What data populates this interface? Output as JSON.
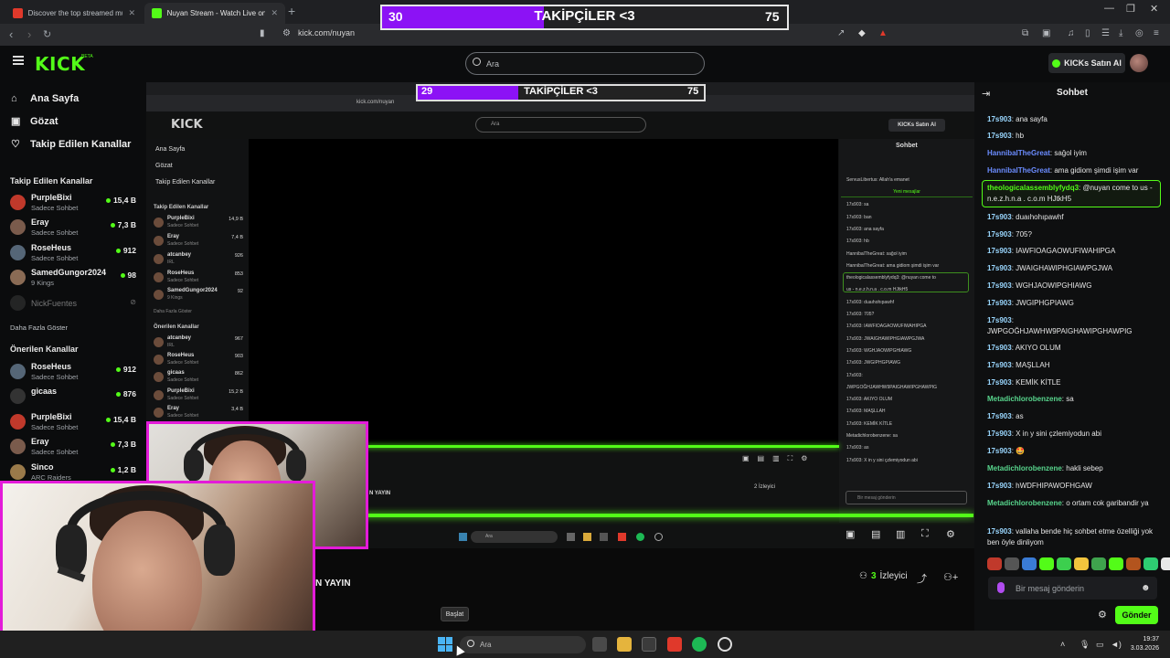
{
  "browser": {
    "tabs": [
      {
        "title": "Discover the top streamed music and"
      },
      {
        "title": "Nuyan Stream - Watch Live on K"
      }
    ],
    "url": "kick.com/nuyan"
  },
  "header": {
    "logo": "KICK",
    "logo_badge": "BETA",
    "search_placeholder": "Ara",
    "buy_label": "KICKs Satın Al"
  },
  "sidebar": {
    "nav": [
      {
        "label": "Ana Sayfa"
      },
      {
        "label": "Gözat"
      },
      {
        "label": "Takip Edilen Kanallar"
      }
    ],
    "followed_title": "Takip Edilen Kanallar",
    "followed": [
      {
        "name": "PurpleBixi",
        "sub": "Sadece Sohbet",
        "count": "15,4 B",
        "color": "#c0392b"
      },
      {
        "name": "Eray",
        "sub": "Sadece Sohbet",
        "count": "7,3 B",
        "color": "#7a5b4c"
      },
      {
        "name": "RoseHeus",
        "sub": "Sadece Sohbet",
        "count": "912",
        "color": "#556677"
      },
      {
        "name": "SamedGungor2024",
        "sub": "9 Kings",
        "count": "98",
        "color": "#8a6b55"
      },
      {
        "name": "NickFuentes",
        "sub": "",
        "count": "",
        "color": "#444"
      }
    ],
    "show_more": "Daha Fazla Göster",
    "recommended_title": "Önerilen Kanallar",
    "recommended": [
      {
        "name": "RoseHeus",
        "sub": "Sadece Sohbet",
        "count": "912",
        "color": "#556677"
      },
      {
        "name": "gicaas",
        "sub": "",
        "count": "876",
        "color": "#333"
      },
      {
        "name": "PurpleBixi",
        "sub": "Sadece Sohbet",
        "count": "15,4 B",
        "color": "#c0392b"
      },
      {
        "name": "Eray",
        "sub": "Sadece Sohbet",
        "count": "7,3 B",
        "color": "#7a5b4c"
      },
      {
        "name": "Sinco",
        "sub": "ARC Raiders",
        "count": "1,2 B",
        "color": "#9a7a4a"
      }
    ]
  },
  "overlay": {
    "current": "30",
    "title": "TAKİPÇİLER <3",
    "goal": "75",
    "progress": 0.4
  },
  "inner_overlay": {
    "current": "29",
    "title": "TAKİPÇİLER <3",
    "goal": "75"
  },
  "inner": {
    "url": "kick.com/nuyan",
    "logo": "KICK",
    "search": "Ara",
    "buy": "KICKs Satın Al",
    "nav": [
      "Ana Sayfa",
      "Gözat",
      "Takip Edilen Kanallar"
    ],
    "followed_title": "Takip Edilen Kanallar",
    "followed": [
      {
        "name": "PurpleBixi",
        "sub": "Sadece Sohbet",
        "count": "14,9 B"
      },
      {
        "name": "Eray",
        "sub": "Sadece Sohbet",
        "count": "7,4 B"
      },
      {
        "name": "atcanbey",
        "sub": "IRL",
        "count": "926"
      },
      {
        "name": "RoseHeus",
        "sub": "Sadece Sohbet",
        "count": "853"
      },
      {
        "name": "SamedGungor2024",
        "sub": "9 Kings",
        "count": "92"
      }
    ],
    "show_more": "Daha Fazla Göster",
    "recommended_title": "Önerilen Kanallar",
    "recommended": [
      {
        "name": "atcanbey",
        "sub": "IRL",
        "count": "967"
      },
      {
        "name": "RoseHeus",
        "sub": "Sadece Sohbet",
        "count": "903"
      },
      {
        "name": "gicaas",
        "sub": "Sadece Sohbet",
        "count": "862"
      },
      {
        "name": "PurpleBixi",
        "sub": "Sadece Sohbet",
        "count": "15,2 B"
      },
      {
        "name": "Eray",
        "sub": "Sadece Sohbet",
        "count": "3,4 B"
      }
    ],
    "chat_title": "Sohbet",
    "new_messages": "Yeni mesajlar",
    "chat": [
      "ServusLibertus: Allah'a emanet",
      "17s903: sa",
      "17s903: ban",
      "17s903: ana sayfa",
      "17s903: hb",
      "HannibalTheGreat: sağol iyim",
      "HannibalTheGreat: ama gidiom şimdi işim var",
      "theologicalassemblyfydq3: @nuyan come to",
      "us - n.e.z.h.n.a . c.o.m HJtkH5",
      "17s903: duaıhohıpawhf",
      "17s903: 705?",
      "17s903: IAWFIOAGAOWUFIWAHIPGA",
      "17s903: JWAIGHAWIPHGIAWPGJWA",
      "17s903: WGHJAOWIPGHIAWG",
      "17s903: JWGIPHGPIAWG",
      "17s903:",
      "JWPGOĞHJAWHW9PAIGHAWIPGHAWPIG",
      "17s903: AKIYO OLUM",
      "17s903: MAŞLLAH",
      "17s903: KEMİK KİTLE",
      "Metadichlorobenzene: sa",
      "17s903: as",
      "17s903: X in y sini çzlemiyodun abi"
    ],
    "viewers": "2 İzleyici",
    "msg_placeholder": "Bir mesaj gönderin",
    "title_fragment": "N YAYIN",
    "taskbar_search": "Ara"
  },
  "stream": {
    "title_fragment": "N YAYIN",
    "viewers_num": "3",
    "viewers_label": "İzleyici"
  },
  "chat": {
    "title": "Sohbet",
    "messages": [
      {
        "user": "17s903",
        "color": "#9ad7ff",
        "text": "ana sayfa"
      },
      {
        "user": "17s903",
        "color": "#9ad7ff",
        "text": "hb"
      },
      {
        "user": "HannibalTheGreat",
        "color": "#6b8cff",
        "text": "sağol iyim"
      },
      {
        "user": "HannibalTheGreat",
        "color": "#6b8cff",
        "text": "ama gidiom şimdi işim var"
      },
      {
        "user": "theologicalassemblyfydq3",
        "color": "#53fc18",
        "text": "@nuyan come to us - n.e.z.h.n.a . c.o.m HJtkH5"
      },
      {
        "user": "17s903",
        "color": "#9ad7ff",
        "text": "duaıhohıpawhf"
      },
      {
        "user": "17s903",
        "color": "#9ad7ff",
        "text": "705?"
      },
      {
        "user": "17s903",
        "color": "#9ad7ff",
        "text": "IAWFIOAGAOWUFIWAHIPGA"
      },
      {
        "user": "17s903",
        "color": "#9ad7ff",
        "text": "JWAIGHAWIPHGIAWPGJWA"
      },
      {
        "user": "17s903",
        "color": "#9ad7ff",
        "text": "WGHJAOWIPGHIAWG"
      },
      {
        "user": "17s903",
        "color": "#9ad7ff",
        "text": "JWGIPHGPIAWG"
      },
      {
        "user": "17s903",
        "color": "#9ad7ff",
        "text": "JWPGOĞHJAWHW9PAIGHAWIPGHAWPIG"
      },
      {
        "user": "17s903",
        "color": "#9ad7ff",
        "text": "AKIYO OLUM"
      },
      {
        "user": "17s903",
        "color": "#9ad7ff",
        "text": "MAŞLLAH"
      },
      {
        "user": "17s903",
        "color": "#9ad7ff",
        "text": "KEMİK KİTLE"
      },
      {
        "user": "Metadichlorobenzene",
        "color": "#58d68d",
        "text": "sa"
      },
      {
        "user": "17s903",
        "color": "#9ad7ff",
        "text": "as"
      },
      {
        "user": "17s903",
        "color": "#9ad7ff",
        "text": "X in y sini çzlemiyodun abi"
      },
      {
        "user": "17s903",
        "color": "#9ad7ff",
        "text": "🤩"
      },
      {
        "user": "Metadichlorobenzene",
        "color": "#58d68d",
        "text": "hakli sebep"
      },
      {
        "user": "17s903",
        "color": "#9ad7ff",
        "text": "hWDFHIPAWOFHGAW"
      },
      {
        "user": "Metadichlorobenzene",
        "color": "#58d68d",
        "text": "o ortam cok garibandir ya"
      },
      {
        "user": "17s903",
        "color": "#9ad7ff",
        "text": "vallaha bende hiç sohbet etme özelliği yok ben öyle dinliyom"
      }
    ],
    "input_placeholder": "Bir mesaj gönderin",
    "send_label": "Gönder"
  },
  "taskbar": {
    "tooltip": "Başlat",
    "search_placeholder": "Ara",
    "time": "19:37",
    "date": "3.03.2026"
  },
  "colors": {
    "accent": "#53fc18",
    "overlay_fill": "#8c12f5",
    "webcam_border": "#e31bd9"
  }
}
